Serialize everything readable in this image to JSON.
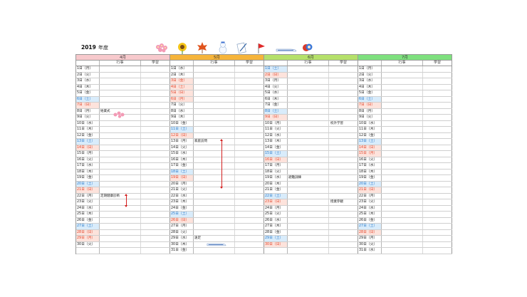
{
  "title": {
    "year": "2019",
    "label": "年度"
  },
  "headers": {
    "event": "行事",
    "study": "学習"
  },
  "colors": {
    "april": "#f7c9cc",
    "may": "#f6b43a",
    "june": "#b5e06a",
    "july": "#7ee07e",
    "saturday_bg": "#d9ecfb",
    "holiday_bg": "#fde3dc"
  },
  "decorations": [
    "cherry-blossom-icon",
    "sunflower-icon",
    "maple-leaf-icon",
    "snowman-icon",
    "pen-note-icon",
    "flag-icon",
    "bullet-train-icon",
    "daruma-icon"
  ],
  "months": [
    {
      "name": "4月",
      "days": [
        {
          "d": "1日（月）",
          "t": "n",
          "ev": "",
          "st": ""
        },
        {
          "d": "2日（火）",
          "t": "n",
          "ev": "",
          "st": ""
        },
        {
          "d": "3日（水）",
          "t": "n",
          "ev": "",
          "st": ""
        },
        {
          "d": "4日（木）",
          "t": "n",
          "ev": "",
          "st": ""
        },
        {
          "d": "5日（金）",
          "t": "n",
          "ev": "",
          "st": ""
        },
        {
          "d": "6日（土）",
          "t": "s",
          "ev": "",
          "st": ""
        },
        {
          "d": "7日（日）",
          "t": "h",
          "ev": "",
          "st": ""
        },
        {
          "d": "8日（月）",
          "t": "n",
          "ev": "始業式",
          "st": ""
        },
        {
          "d": "9日（火）",
          "t": "n",
          "ev": "",
          "st": ""
        },
        {
          "d": "10日（水）",
          "t": "n",
          "ev": "",
          "st": ""
        },
        {
          "d": "11日（木）",
          "t": "n",
          "ev": "",
          "st": ""
        },
        {
          "d": "12日（金）",
          "t": "n",
          "ev": "",
          "st": ""
        },
        {
          "d": "13日（土）",
          "t": "s",
          "ev": "",
          "st": ""
        },
        {
          "d": "14日（日）",
          "t": "h",
          "ev": "",
          "st": ""
        },
        {
          "d": "15日（月）",
          "t": "n",
          "ev": "",
          "st": ""
        },
        {
          "d": "16日（火）",
          "t": "n",
          "ev": "",
          "st": ""
        },
        {
          "d": "17日（水）",
          "t": "n",
          "ev": "",
          "st": ""
        },
        {
          "d": "18日（木）",
          "t": "n",
          "ev": "",
          "st": ""
        },
        {
          "d": "19日（金）",
          "t": "n",
          "ev": "",
          "st": ""
        },
        {
          "d": "20日（土）",
          "t": "s",
          "ev": "",
          "st": ""
        },
        {
          "d": "21日（日）",
          "t": "h",
          "ev": "",
          "st": ""
        },
        {
          "d": "22日（月）",
          "t": "n",
          "ev": "定期健康診断",
          "st": ""
        },
        {
          "d": "23日（火）",
          "t": "n",
          "ev": "",
          "st": ""
        },
        {
          "d": "24日（水）",
          "t": "n",
          "ev": "",
          "st": ""
        },
        {
          "d": "25日（木）",
          "t": "n",
          "ev": "",
          "st": ""
        },
        {
          "d": "26日（金）",
          "t": "n",
          "ev": "",
          "st": ""
        },
        {
          "d": "27日（土）",
          "t": "s",
          "ev": "",
          "st": ""
        },
        {
          "d": "28日（日）",
          "t": "h",
          "ev": "",
          "st": ""
        },
        {
          "d": "29日（月）",
          "t": "h",
          "ev": "",
          "st": ""
        },
        {
          "d": "30日（火）",
          "t": "n",
          "ev": "",
          "st": ""
        },
        {
          "d": "",
          "t": "e",
          "ev": "",
          "st": ""
        }
      ]
    },
    {
      "name": "5月",
      "days": [
        {
          "d": "1日（水）",
          "t": "n",
          "ev": "",
          "st": ""
        },
        {
          "d": "2日（木）",
          "t": "n",
          "ev": "",
          "st": ""
        },
        {
          "d": "3日（金）",
          "t": "h",
          "ev": "",
          "st": ""
        },
        {
          "d": "4日（土）",
          "t": "h",
          "ev": "",
          "st": ""
        },
        {
          "d": "5日（日）",
          "t": "h",
          "ev": "",
          "st": ""
        },
        {
          "d": "6日（月）",
          "t": "h",
          "ev": "",
          "st": ""
        },
        {
          "d": "7日（火）",
          "t": "n",
          "ev": "",
          "st": ""
        },
        {
          "d": "8日（水）",
          "t": "n",
          "ev": "",
          "st": ""
        },
        {
          "d": "9日（木）",
          "t": "n",
          "ev": "",
          "st": ""
        },
        {
          "d": "10日（金）",
          "t": "n",
          "ev": "",
          "st": ""
        },
        {
          "d": "11日（土）",
          "t": "s",
          "ev": "",
          "st": ""
        },
        {
          "d": "12日（日）",
          "t": "h",
          "ev": "",
          "st": ""
        },
        {
          "d": "13日（月）",
          "t": "n",
          "ev": "家庭訪問",
          "st": ""
        },
        {
          "d": "14日（火）",
          "t": "n",
          "ev": "",
          "st": ""
        },
        {
          "d": "15日（水）",
          "t": "n",
          "ev": "",
          "st": ""
        },
        {
          "d": "16日（木）",
          "t": "n",
          "ev": "",
          "st": ""
        },
        {
          "d": "17日（金）",
          "t": "n",
          "ev": "",
          "st": ""
        },
        {
          "d": "18日（土）",
          "t": "s",
          "ev": "",
          "st": ""
        },
        {
          "d": "19日（日）",
          "t": "h",
          "ev": "",
          "st": ""
        },
        {
          "d": "20日（月）",
          "t": "n",
          "ev": "",
          "st": ""
        },
        {
          "d": "21日（火）",
          "t": "n",
          "ev": "",
          "st": ""
        },
        {
          "d": "22日（水）",
          "t": "n",
          "ev": "",
          "st": ""
        },
        {
          "d": "23日（木）",
          "t": "n",
          "ev": "",
          "st": ""
        },
        {
          "d": "24日（金）",
          "t": "n",
          "ev": "",
          "st": ""
        },
        {
          "d": "25日（土）",
          "t": "s",
          "ev": "",
          "st": ""
        },
        {
          "d": "26日（日）",
          "t": "h",
          "ev": "",
          "st": ""
        },
        {
          "d": "27日（月）",
          "t": "n",
          "ev": "",
          "st": ""
        },
        {
          "d": "28日（火）",
          "t": "n",
          "ev": "",
          "st": ""
        },
        {
          "d": "29日（水）",
          "t": "n",
          "ev": "遠足",
          "st": ""
        },
        {
          "d": "30日（木）",
          "t": "n",
          "ev": "",
          "st": ""
        },
        {
          "d": "31日（金）",
          "t": "n",
          "ev": "",
          "st": ""
        }
      ]
    },
    {
      "name": "6月",
      "days": [
        {
          "d": "1日（土）",
          "t": "s",
          "ev": "",
          "st": ""
        },
        {
          "d": "2日（日）",
          "t": "h",
          "ev": "",
          "st": ""
        },
        {
          "d": "3日（月）",
          "t": "n",
          "ev": "",
          "st": ""
        },
        {
          "d": "4日（火）",
          "t": "n",
          "ev": "",
          "st": ""
        },
        {
          "d": "5日（水）",
          "t": "n",
          "ev": "",
          "st": ""
        },
        {
          "d": "6日（木）",
          "t": "n",
          "ev": "",
          "st": ""
        },
        {
          "d": "7日（金）",
          "t": "n",
          "ev": "",
          "st": ""
        },
        {
          "d": "8日（土）",
          "t": "s",
          "ev": "",
          "st": ""
        },
        {
          "d": "9日（日）",
          "t": "h",
          "ev": "",
          "st": ""
        },
        {
          "d": "10日（月）",
          "t": "n",
          "ev": "",
          "st": "校外学習"
        },
        {
          "d": "11日（火）",
          "t": "n",
          "ev": "",
          "st": ""
        },
        {
          "d": "12日（水）",
          "t": "n",
          "ev": "",
          "st": ""
        },
        {
          "d": "13日（木）",
          "t": "n",
          "ev": "",
          "st": ""
        },
        {
          "d": "14日（金）",
          "t": "n",
          "ev": "",
          "st": ""
        },
        {
          "d": "15日（土）",
          "t": "s",
          "ev": "",
          "st": ""
        },
        {
          "d": "16日（日）",
          "t": "h",
          "ev": "",
          "st": ""
        },
        {
          "d": "17日（月）",
          "t": "n",
          "ev": "",
          "st": ""
        },
        {
          "d": "18日（火）",
          "t": "n",
          "ev": "",
          "st": ""
        },
        {
          "d": "19日（水）",
          "t": "n",
          "ev": "避難訓練",
          "st": ""
        },
        {
          "d": "20日（木）",
          "t": "n",
          "ev": "",
          "st": ""
        },
        {
          "d": "21日（金）",
          "t": "n",
          "ev": "",
          "st": ""
        },
        {
          "d": "22日（土）",
          "t": "s",
          "ev": "",
          "st": ""
        },
        {
          "d": "23日（日）",
          "t": "h",
          "ev": "",
          "st": "授業参観"
        },
        {
          "d": "24日（月）",
          "t": "n",
          "ev": "",
          "st": ""
        },
        {
          "d": "25日（火）",
          "t": "n",
          "ev": "",
          "st": ""
        },
        {
          "d": "26日（水）",
          "t": "n",
          "ev": "",
          "st": ""
        },
        {
          "d": "27日（木）",
          "t": "n",
          "ev": "",
          "st": ""
        },
        {
          "d": "28日（金）",
          "t": "n",
          "ev": "",
          "st": ""
        },
        {
          "d": "29日（土）",
          "t": "s",
          "ev": "",
          "st": ""
        },
        {
          "d": "30日（日）",
          "t": "h",
          "ev": "",
          "st": ""
        },
        {
          "d": "",
          "t": "e",
          "ev": "",
          "st": ""
        }
      ]
    },
    {
      "name": "7月",
      "days": [
        {
          "d": "1日（月）",
          "t": "n",
          "ev": "",
          "st": ""
        },
        {
          "d": "2日（火）",
          "t": "n",
          "ev": "",
          "st": ""
        },
        {
          "d": "3日（水）",
          "t": "n",
          "ev": "",
          "st": ""
        },
        {
          "d": "4日（木）",
          "t": "n",
          "ev": "",
          "st": ""
        },
        {
          "d": "5日（金）",
          "t": "n",
          "ev": "",
          "st": ""
        },
        {
          "d": "6日（土）",
          "t": "s",
          "ev": "",
          "st": ""
        },
        {
          "d": "7日（日）",
          "t": "h",
          "ev": "",
          "st": ""
        },
        {
          "d": "8日（月）",
          "t": "n",
          "ev": "",
          "st": ""
        },
        {
          "d": "9日（火）",
          "t": "n",
          "ev": "",
          "st": ""
        },
        {
          "d": "10日（水）",
          "t": "n",
          "ev": "",
          "st": ""
        },
        {
          "d": "11日（木）",
          "t": "n",
          "ev": "",
          "st": ""
        },
        {
          "d": "12日（金）",
          "t": "n",
          "ev": "",
          "st": ""
        },
        {
          "d": "13日（土）",
          "t": "s",
          "ev": "",
          "st": ""
        },
        {
          "d": "14日（日）",
          "t": "h",
          "ev": "",
          "st": ""
        },
        {
          "d": "15日（月）",
          "t": "h",
          "ev": "",
          "st": ""
        },
        {
          "d": "16日（火）",
          "t": "n",
          "ev": "",
          "st": ""
        },
        {
          "d": "17日（水）",
          "t": "n",
          "ev": "",
          "st": ""
        },
        {
          "d": "18日（木）",
          "t": "n",
          "ev": "",
          "st": ""
        },
        {
          "d": "19日（金）",
          "t": "n",
          "ev": "",
          "st": ""
        },
        {
          "d": "20日（土）",
          "t": "s",
          "ev": "",
          "st": ""
        },
        {
          "d": "21日（日）",
          "t": "h",
          "ev": "",
          "st": ""
        },
        {
          "d": "22日（月）",
          "t": "n",
          "ev": "",
          "st": ""
        },
        {
          "d": "23日（火）",
          "t": "n",
          "ev": "",
          "st": ""
        },
        {
          "d": "24日（水）",
          "t": "n",
          "ev": "",
          "st": ""
        },
        {
          "d": "25日（木）",
          "t": "n",
          "ev": "",
          "st": ""
        },
        {
          "d": "26日（金）",
          "t": "n",
          "ev": "",
          "st": ""
        },
        {
          "d": "27日（土）",
          "t": "s",
          "ev": "",
          "st": ""
        },
        {
          "d": "28日（日）",
          "t": "h",
          "ev": "",
          "st": ""
        },
        {
          "d": "29日（月）",
          "t": "n",
          "ev": "",
          "st": ""
        },
        {
          "d": "30日（火）",
          "t": "n",
          "ev": "",
          "st": ""
        },
        {
          "d": "31日（水）",
          "t": "n",
          "ev": "",
          "st": ""
        }
      ]
    }
  ]
}
